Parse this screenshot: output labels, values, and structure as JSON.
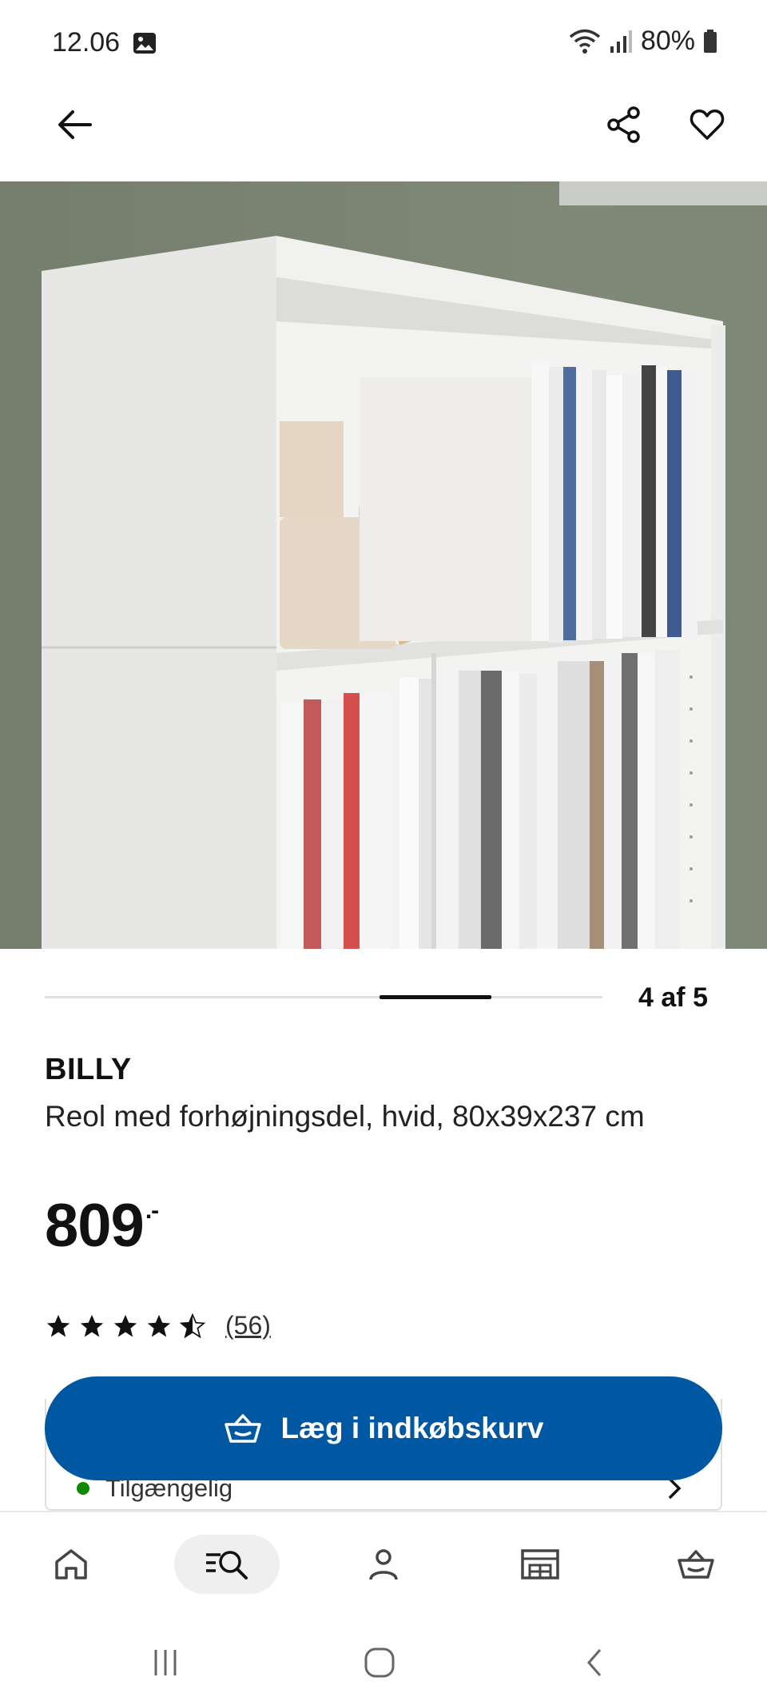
{
  "status_bar": {
    "time": "12.06",
    "battery": "80%"
  },
  "carousel": {
    "counter": "4 af 5",
    "current": 4,
    "total": 5
  },
  "product": {
    "brand": "BILLY",
    "description": "Reol med forhøjningsdel, hvid, 80x39x237 cm",
    "price": "809",
    "price_suffix": ".-",
    "rating": 4.5,
    "review_count": "(56)"
  },
  "actions": {
    "add_to_cart": "Læg i indkøbskurv"
  },
  "availability": {
    "label": "Tilgængelig",
    "status_color": "#0a8a00"
  },
  "bottom_nav": [
    {
      "icon": "home-icon"
    },
    {
      "icon": "search-icon",
      "active": true
    },
    {
      "icon": "profile-icon"
    },
    {
      "icon": "store-icon"
    },
    {
      "icon": "cart-icon"
    }
  ],
  "colors": {
    "brand_blue": "#0058a3",
    "wall": "#7b8473"
  }
}
